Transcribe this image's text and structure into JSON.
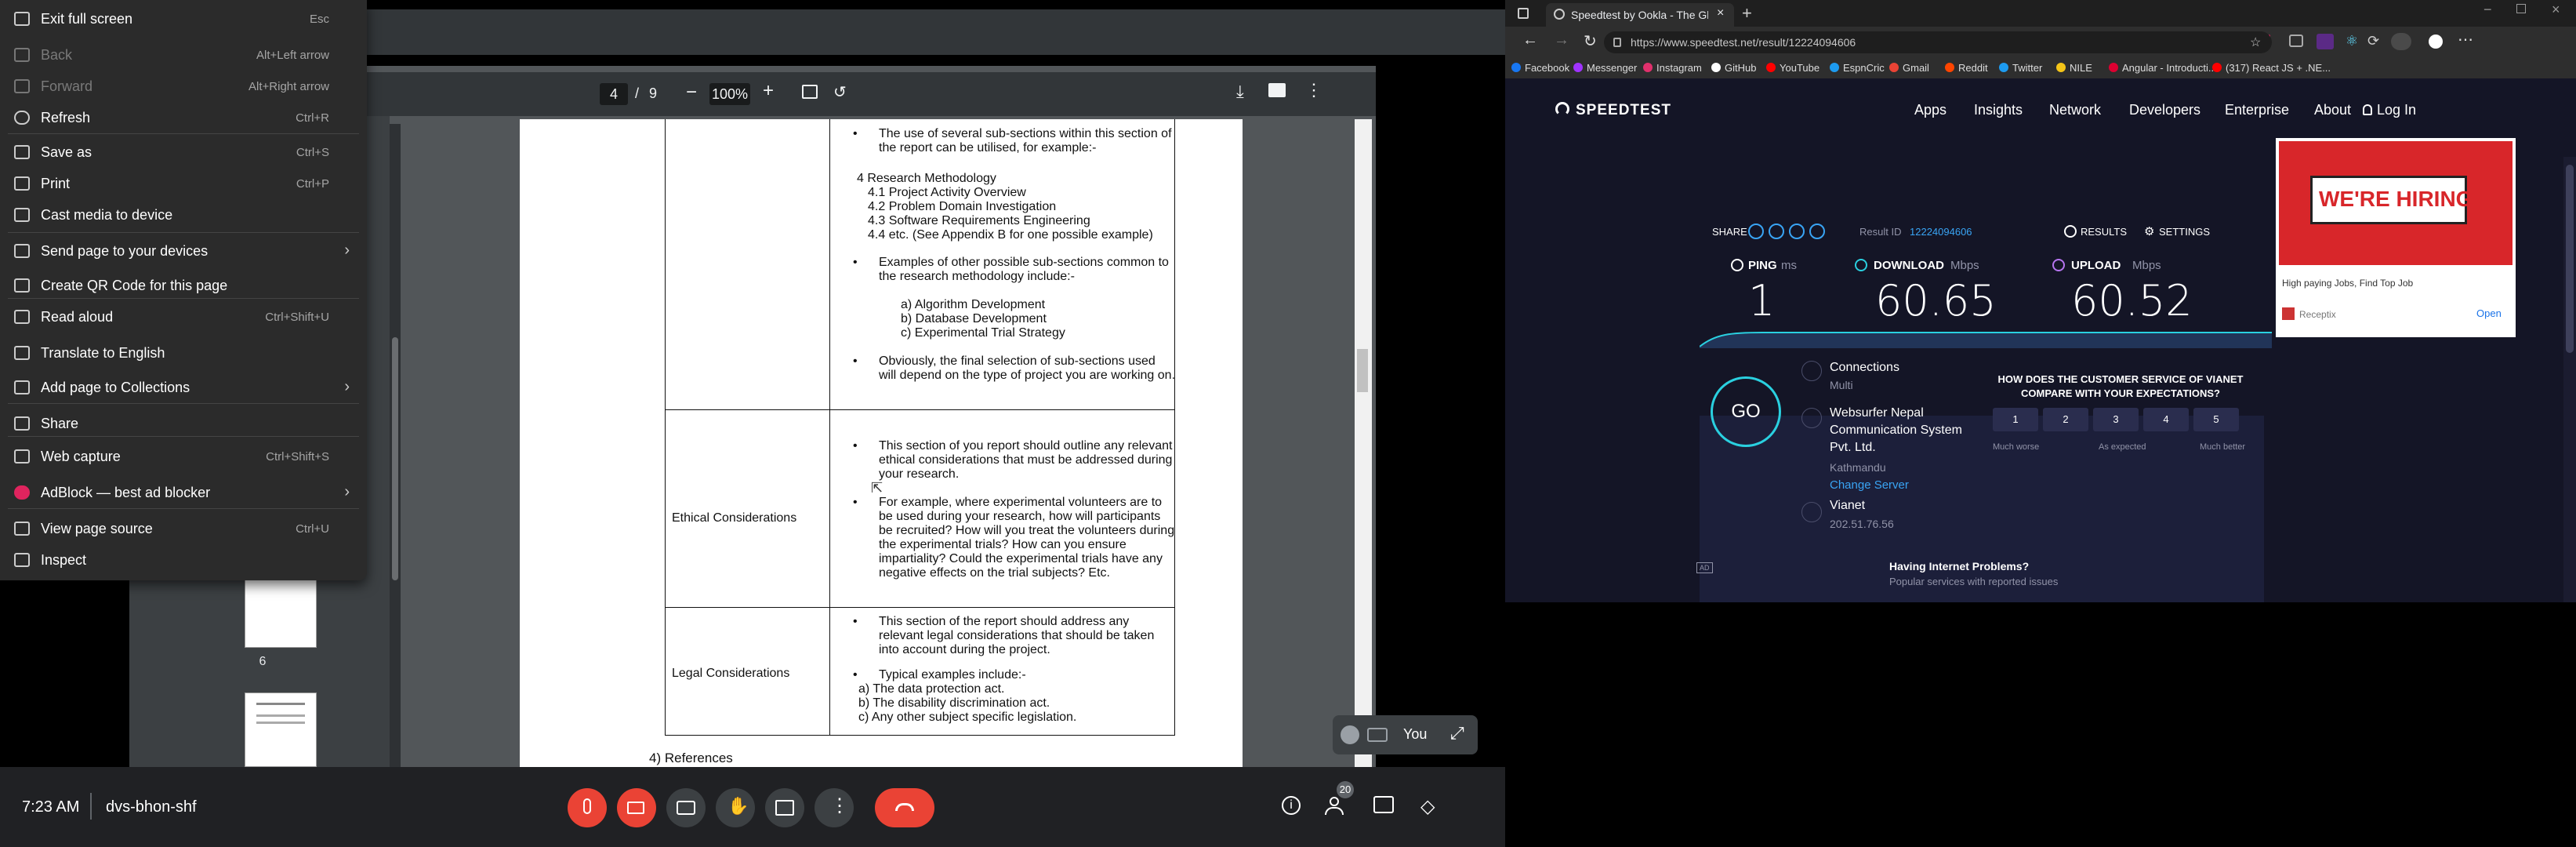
{
  "meet": {
    "pdf": {
      "page_current": "4",
      "page_sep": "/",
      "page_total": "9",
      "zoom": "100%",
      "thumb_label": "6",
      "doc": {
        "l1": "The use of several sub-sections within this section of",
        "l2": "the report can be utilised, for example:-",
        "rm": "4 Research Methodology",
        "rm1": "4.1 Project Activity Overview",
        "rm2": "4.2 Problem Domain Investigation",
        "rm3": "4.3 Software Requirements Engineering",
        "rm4": "4.4 etc.  (See Appendix B for one possible example)",
        "ex1": "Examples of other possible sub-sections common to",
        "ex2": "the research methodology include:-",
        "a": "a)   Algorithm Development",
        "b": "b)   Database Development",
        "c": "c)   Experimental Trial Strategy",
        "ob1": "Obviously, the final selection of sub-sections used",
        "ob2": "will depend on the type of project you are working on.",
        "ethics_label": "Ethical Considerations",
        "e1": "This section of you report should outline any relevant",
        "e2": "ethical considerations that must be addressed during",
        "e3": "your research.",
        "f1": "For example, where experimental volunteers are to",
        "f2": "be used during your research, how will participants",
        "f3": "be recruited? How will you treat the volunteers during",
        "f4": "the experimental trials? How can you ensure",
        "f5": "impartiality? Could the experimental trials have any",
        "f6": "negative effects on the trial subjects? Etc.",
        "legal_label": "Legal Considerations",
        "g1": "This section of the report should address any",
        "g2": "relevant legal considerations that should be taken",
        "g3": "into account during the project.",
        "t1": "Typical examples include:-",
        "t2": "a)   The data protection act.",
        "t3": "b)   The disability discrimination act.",
        "t4": "c)   Any other subject specific legislation.",
        "refs": "4)  References"
      }
    },
    "context_menu": [
      {
        "label": "Exit full screen",
        "shortcut": "Esc",
        "icon": "exit-fullscreen-icon"
      },
      {
        "label": "Back",
        "shortcut": "Alt+Left arrow",
        "icon": "back-arrow-icon",
        "disabled": true
      },
      {
        "label": "Forward",
        "shortcut": "Alt+Right arrow",
        "icon": "forward-arrow-icon",
        "disabled": true
      },
      {
        "label": "Refresh",
        "shortcut": "Ctrl+R",
        "icon": "refresh-icon"
      },
      {
        "label": "Save as",
        "shortcut": "Ctrl+S",
        "icon": "save-icon"
      },
      {
        "label": "Print",
        "shortcut": "Ctrl+P",
        "icon": "print-icon"
      },
      {
        "label": "Cast media to device",
        "shortcut": "",
        "icon": "cast-icon"
      },
      {
        "label": "Send page to your devices",
        "shortcut": "",
        "icon": "send-device-icon"
      },
      {
        "label": "Create QR Code for this page",
        "shortcut": "",
        "icon": "qr-code-icon"
      },
      {
        "label": "Read aloud",
        "shortcut": "Ctrl+Shift+U",
        "icon": "read-aloud-icon"
      },
      {
        "label": "Translate to English",
        "shortcut": "",
        "icon": "translate-icon"
      },
      {
        "label": "Add page to Collections",
        "shortcut": "",
        "icon": "collections-icon"
      },
      {
        "label": "Share",
        "shortcut": "",
        "icon": "share-icon"
      },
      {
        "label": "Web capture",
        "shortcut": "Ctrl+Shift+S",
        "icon": "web-capture-icon"
      },
      {
        "label": "AdBlock — best ad blocker",
        "shortcut": "",
        "icon": "adblock-icon"
      },
      {
        "label": "View page source",
        "shortcut": "Ctrl+U",
        "icon": "view-source-icon"
      },
      {
        "label": "Inspect",
        "shortcut": "",
        "icon": "inspect-icon"
      }
    ],
    "self_label": "You",
    "clock": "7:23 AM",
    "meeting_code": "dvs-bhon-shf",
    "participants_count": "20",
    "colors": {
      "hangup": "#ea4335",
      "muted": "#ea4335",
      "panel": "#202124"
    }
  },
  "browser": {
    "tab_title": "Speedtest by Ookla - The Global",
    "url": "https://www.speedtest.net/result/12224094606",
    "bookmarks": [
      "Facebook",
      "Messenger",
      "Instagram",
      "GitHub",
      "YouTube",
      "EspnCric",
      "Gmail",
      "Reddit",
      "Twitter",
      "NILE",
      "Angular - Introducti...",
      "(317) React JS + .NE..."
    ],
    "bookmark_colors": [
      "#1877f2",
      "#a033ff",
      "#e1306c",
      "#ffffff",
      "#ff0000",
      "#1d9bf0",
      "#ea4335",
      "#ff4500",
      "#1d9bf0",
      "#f5c518",
      "#dd0031",
      "#ff0000"
    ]
  },
  "speedtest": {
    "logo": "SPEEDTEST",
    "nav": [
      "Apps",
      "Insights",
      "Network",
      "Developers",
      "Enterprise",
      "About",
      "Log In"
    ],
    "share_label": "SHARE",
    "result_id_label": "Result ID",
    "result_id": "12224094606",
    "results_label": "RESULTS",
    "settings_label": "SETTINGS",
    "ping_label": "PING",
    "ping_unit": "ms",
    "ping_value": "1",
    "download_label": "DOWNLOAD",
    "download_unit": "Mbps",
    "download_value": "60.65",
    "upload_label": "UPLOAD",
    "upload_unit": "Mbps",
    "upload_value": "60.52",
    "go_label": "GO",
    "connections_label": "Connections",
    "connections_value": "Multi",
    "server_name_1": "Websurfer Nepal",
    "server_name_2": "Communication System",
    "server_name_3": "Pvt. Ltd.",
    "server_city": "Kathmandu",
    "change_server": "Change Server",
    "isp": "Vianet",
    "ip": "202.51.76.56",
    "survey_q1": "HOW DOES THE CUSTOMER SERVICE OF VIANET",
    "survey_q2": "COMPARE WITH YOUR EXPECTATIONS?",
    "survey_options": [
      "1",
      "2",
      "3",
      "4",
      "5"
    ],
    "survey_low": "Much worse",
    "survey_mid": "As expected",
    "survey_high": "Much better",
    "ad_label": "AD",
    "problems_title": "Having Internet Problems?",
    "problems_sub": "Popular services with reported issues",
    "ad_headline": "WE'RE HIRING!",
    "ad_text": "High paying Jobs, Find Top Job",
    "ad_brand": "Receptix",
    "ad_open": "Open",
    "colors": {
      "bg": "#141526",
      "panel": "#1e2140",
      "accent": "#2ad0e0",
      "upload": "#b675f0",
      "link": "#39a4f4"
    }
  }
}
